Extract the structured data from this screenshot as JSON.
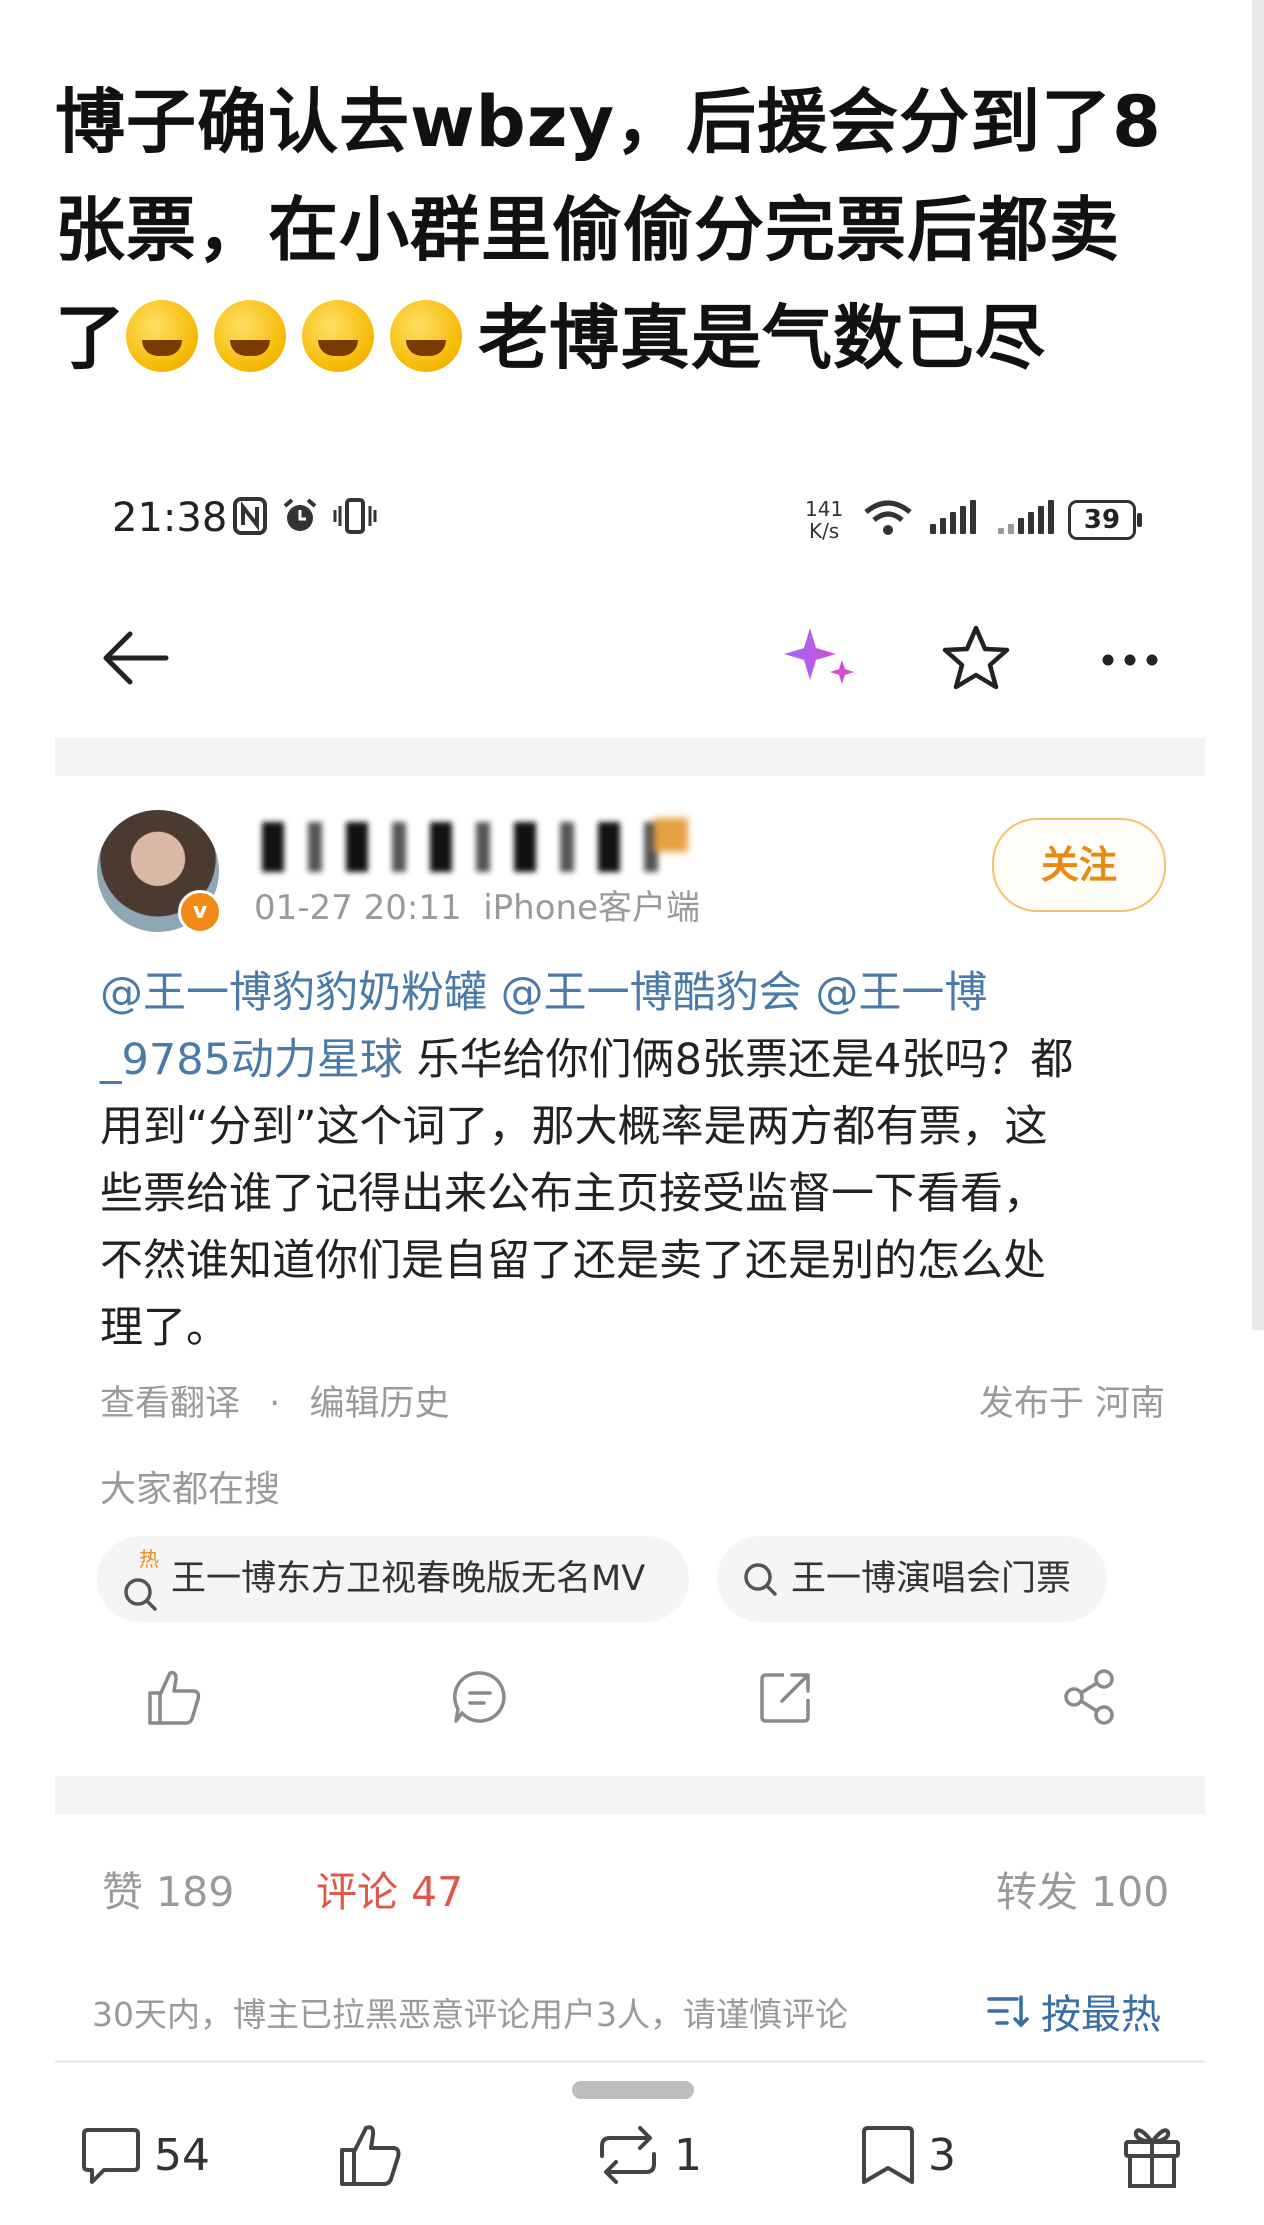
{
  "headline": {
    "line1": "博子确认去wbzy，后援会分到了8",
    "line2": "张票，在小群里偷偷分完票后都卖",
    "line3_prefix": "了",
    "line3_suffix": "老博真是气数已尽",
    "emoji_icon": "rolling-on-floor-laughing-emoji",
    "emoji_count": 4
  },
  "status_bar": {
    "time": "21:38",
    "net_speed_value": "141",
    "net_speed_unit": "K/s",
    "battery": "39"
  },
  "post": {
    "verified_badge": "v",
    "date": "01-27 20:11",
    "client": "iPhone客户端",
    "follow_label": "关注",
    "mention_1": "@王一博豹豹奶粉罐",
    "mention_2": "@王一博酷豹会",
    "mention_3a": "@王一博",
    "mention_3b": "_9785动力星球",
    "text_1": "乐华给你们俩8张票还是4张吗？都",
    "text_2": "用到“分到”这个词了，那大概率是两方都有票，这",
    "text_3": "些票给谁了记得出来公布主页接受监督一下看看，",
    "text_4": "不然谁知道你们是自留了还是卖了还是别的怎么处",
    "text_5": "理了。",
    "translate_label": "查看翻译",
    "separator": "·",
    "edit_history_label": "编辑历史",
    "location": "发布于 河南"
  },
  "search": {
    "title": "大家都在搜",
    "chips": [
      {
        "label": "王一博东方卫视春晚版无名MV",
        "hot_badge": "热"
      },
      {
        "label": "王一博演唱会门票"
      }
    ]
  },
  "stats": {
    "like": "赞 189",
    "comment": "评论 47",
    "repost": "转发 100"
  },
  "comment_notice": "30天内，博主已拉黑恶意评论用户3人，请谨慎评论",
  "sort_label": "按最热",
  "bottom_bar": {
    "comment_count": "54",
    "repost_count": "1",
    "favorite_count": "3"
  },
  "colors": {
    "mention": "#4b7aa8",
    "follow": "#e88a10",
    "comment_active": "#e0574a",
    "sort": "#3a6ea5"
  }
}
